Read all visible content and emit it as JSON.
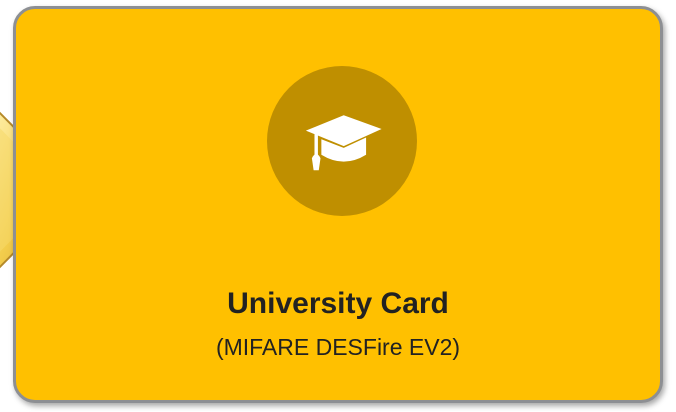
{
  "card": {
    "title": "University Card",
    "subtitle": "(MIFARE DESFire EV2)",
    "icon": "graduation-cap-icon",
    "background_color": "#ffc000",
    "emblem_color": "#bf8f00",
    "border_color": "#8d8f93"
  },
  "arrow": {
    "icon": "chevron-right-arrow",
    "color": "#f2c94c"
  }
}
